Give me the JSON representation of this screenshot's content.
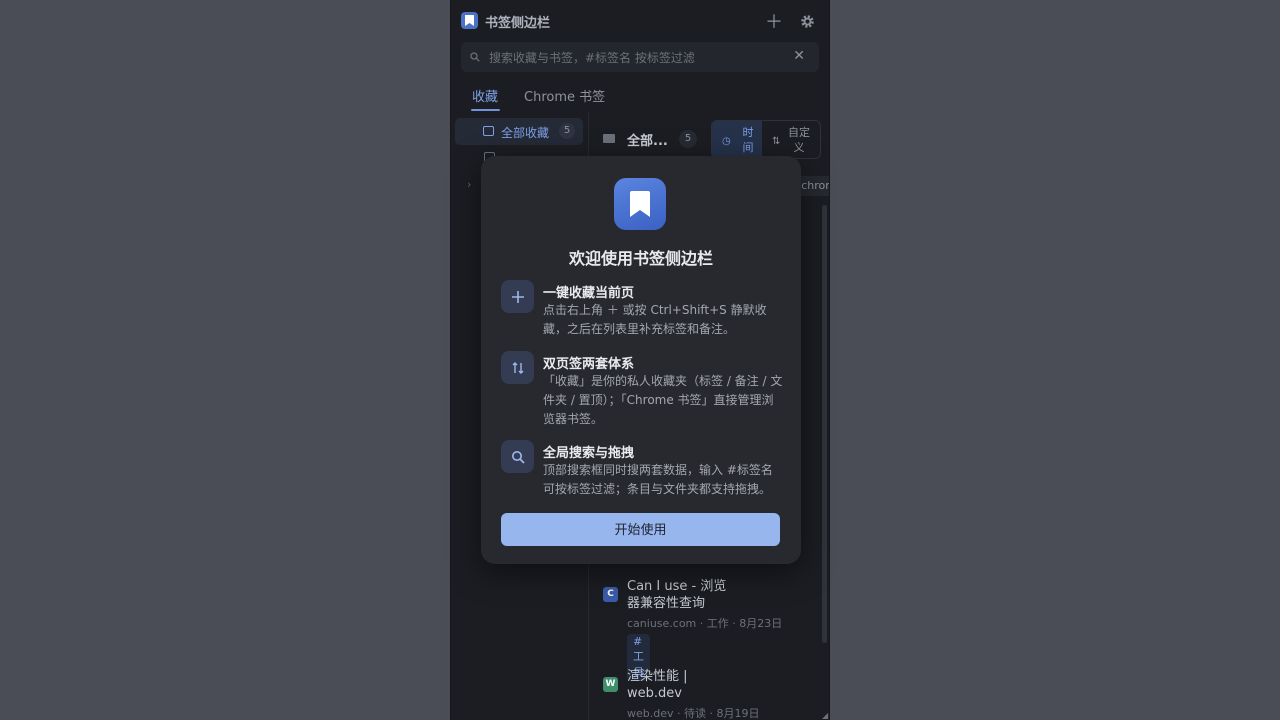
{
  "header": {
    "title": "书签侧边栏",
    "add_icon": "plus-icon",
    "settings_icon": "gear-icon"
  },
  "search": {
    "placeholder": "搜索收藏与书签，#标签名 按标签过滤",
    "value": ""
  },
  "tabs": [
    {
      "label": "收藏",
      "active": true
    },
    {
      "label": "Chrome 书签",
      "active": false
    }
  ],
  "sidebar": {
    "items": [
      {
        "label": "全部收藏",
        "count": "5"
      }
    ]
  },
  "folder": {
    "name": "全部...",
    "count": "5"
  },
  "sort": {
    "time_label": "时间",
    "custom_label": "自定义"
  },
  "tag_chip": "#chrom",
  "bookmarks": [
    {
      "favicon": "C",
      "favicon_color": "#3a5ca8",
      "title": "Can I use - 浏览器兼容性查询",
      "meta": "caniuse.com · 工作 · 8月23日",
      "tag": "#工具"
    },
    {
      "favicon": "W",
      "favicon_color": "#3f8f6c",
      "title": "渲染性能 | web.dev",
      "meta": "web.dev · 待读 · 8月19日",
      "tag": ""
    }
  ],
  "modal": {
    "title": "欢迎使用书签侧边栏",
    "features": [
      {
        "icon": "plus-icon",
        "title": "一键收藏当前页",
        "desc": "点击右上角 ＋ 或按 Ctrl+Shift+S 静默收藏，之后在列表里补充标签和备注。"
      },
      {
        "icon": "swap-vertical-icon",
        "title": "双页签两套体系",
        "desc": "「收藏」是你的私人收藏夹（标签 / 备注 / 文件夹 / 置顶）；「Chrome 书签」直接管理浏览器书签。"
      },
      {
        "icon": "search-icon",
        "title": "全局搜索与拖拽",
        "desc": "顶部搜索框同时搜两套数据，输入 #标签名 可按标签过滤；条目与文件夹都支持拖拽。"
      }
    ],
    "start_button": "开始使用"
  },
  "colors": {
    "accent": "#7fa0e6",
    "button": "#98b6ee",
    "panel_bg": "#1b1d22",
    "modal_bg": "#27292e"
  }
}
